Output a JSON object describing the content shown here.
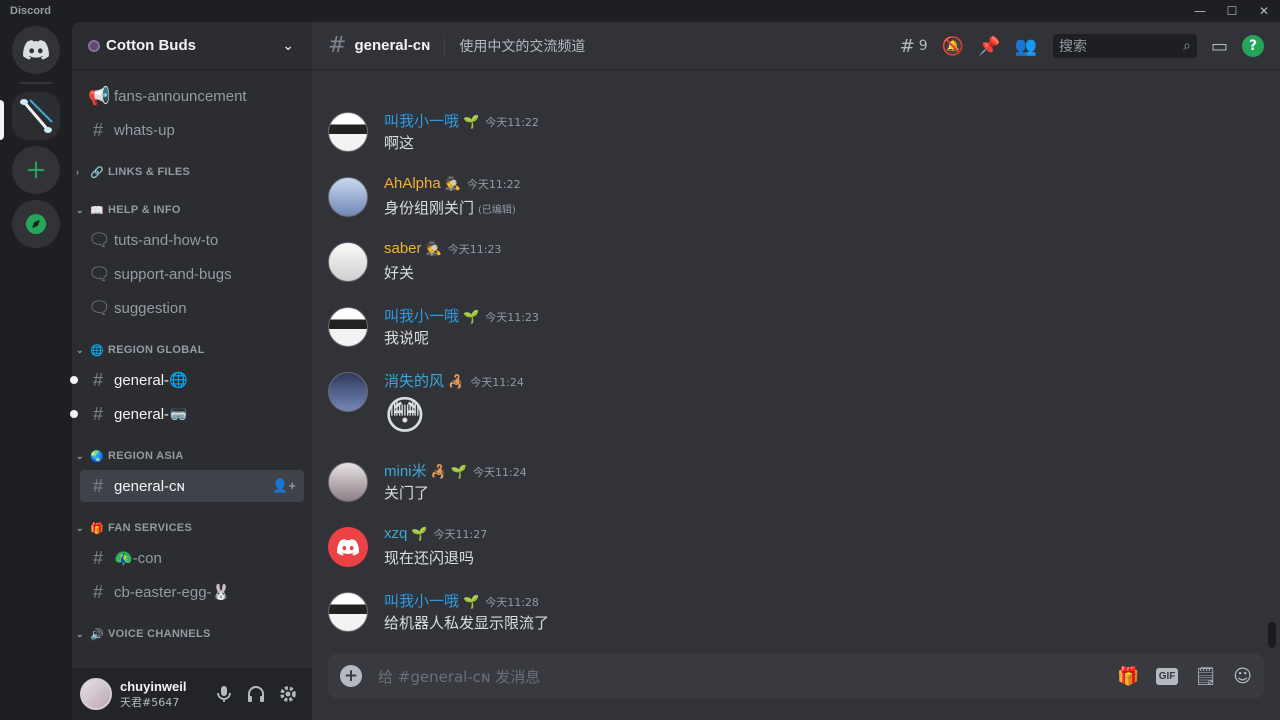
{
  "window": {
    "title": "Discord",
    "minimize": "—",
    "maximize": "☐",
    "close": "✕"
  },
  "colors": {
    "accent": "#5865f2",
    "online": "#23a55a",
    "mention_red": "#ed4245"
  },
  "server": {
    "name": "Cotton Buds"
  },
  "sidebar": {
    "channels_top": [
      {
        "icon": "megaphone-icon",
        "glyph": "📢",
        "name": "fans-announcement"
      },
      {
        "icon": "hash-icon",
        "glyph": "#",
        "name": "whats-up"
      }
    ],
    "categories": [
      {
        "name": "LINKS & FILES",
        "icon": "🔗",
        "collapsed": true,
        "channels": []
      },
      {
        "name": "HELP & INFO",
        "icon": "📖",
        "channels": [
          {
            "icon": "forum-icon",
            "glyph": "🗨",
            "name": "tuts-and-how-to"
          },
          {
            "icon": "forum-icon",
            "glyph": "🗨",
            "name": "support-and-bugs"
          },
          {
            "icon": "forum-icon",
            "glyph": "🗨",
            "name": "suggestion"
          }
        ]
      },
      {
        "name": "REGION GLOBAL",
        "icon": "🌐",
        "channels": [
          {
            "icon": "hash-icon",
            "glyph": "#",
            "name": "general-🌐",
            "unread": true
          },
          {
            "icon": "hash-icon",
            "glyph": "#",
            "name": "general-🥽",
            "unread": true
          }
        ]
      },
      {
        "name": "REGION ASIA",
        "icon": "🌏",
        "channels": [
          {
            "icon": "hash-lock-icon",
            "glyph": "#",
            "name": "general-ᴄɴ",
            "active": true
          }
        ]
      },
      {
        "name": "FAN SERVICES",
        "icon": "🎁",
        "channels": [
          {
            "icon": "hash-icon",
            "glyph": "#",
            "name": "🦚-con"
          },
          {
            "icon": "hash-icon",
            "glyph": "#",
            "name": "cb-easter-egg-🐰"
          }
        ]
      },
      {
        "name": "VOICE CHANNELS",
        "icon": "🔊",
        "channels": []
      }
    ]
  },
  "user": {
    "name": "chuyinweil",
    "tag": "天君#5647"
  },
  "channel": {
    "name": "general-ᴄɴ",
    "topic": "使用中文的交流频道",
    "threads_count": "9"
  },
  "search": {
    "placeholder": "搜索"
  },
  "messages": [
    {
      "author": "叫我小一哦",
      "color": "#2e9ae0",
      "badges": "🌱",
      "time": "今天11:22",
      "text": "啊这",
      "avatar": "av-dark"
    },
    {
      "author": "AhAlpha",
      "color": "#f0b232",
      "badges": "🕵",
      "time": "今天11:22",
      "text": "身份组刚关门",
      "edited": "(已编辑)",
      "avatar": "av-blue"
    },
    {
      "author": "saber",
      "color": "#f0b232",
      "badges": "🕵",
      "time": "今天11:23",
      "text": "好关",
      "avatar": "av-white"
    },
    {
      "author": "叫我小一哦",
      "color": "#2e9ae0",
      "badges": "🌱",
      "time": "今天11:23",
      "text": "我说呢",
      "avatar": "av-dark"
    },
    {
      "author": "消失的风",
      "color": "#3ba7d6",
      "badges": "🦂",
      "time": "今天11:24",
      "text": "😳",
      "big_emoji": true,
      "avatar": "av-night"
    },
    {
      "author": "mini米",
      "color": "#3ba7d6",
      "badges": "🦂 🌱",
      "time": "今天11:24",
      "text": "关门了",
      "avatar": "av-grey"
    },
    {
      "author": "xzq",
      "color": "#3ba7d6",
      "badges": "🌱",
      "time": "今天11:27",
      "text": "现在还闪退吗",
      "avatar": "av-red"
    },
    {
      "author": "叫我小一哦",
      "color": "#2e9ae0",
      "badges": "🌱",
      "time": "今天11:28",
      "text": "给机器人私发显示限流了",
      "avatar": "av-dark"
    }
  ],
  "composer": {
    "placeholder": "给 #general-ᴄɴ 发消息",
    "gif_label": "GIF"
  }
}
